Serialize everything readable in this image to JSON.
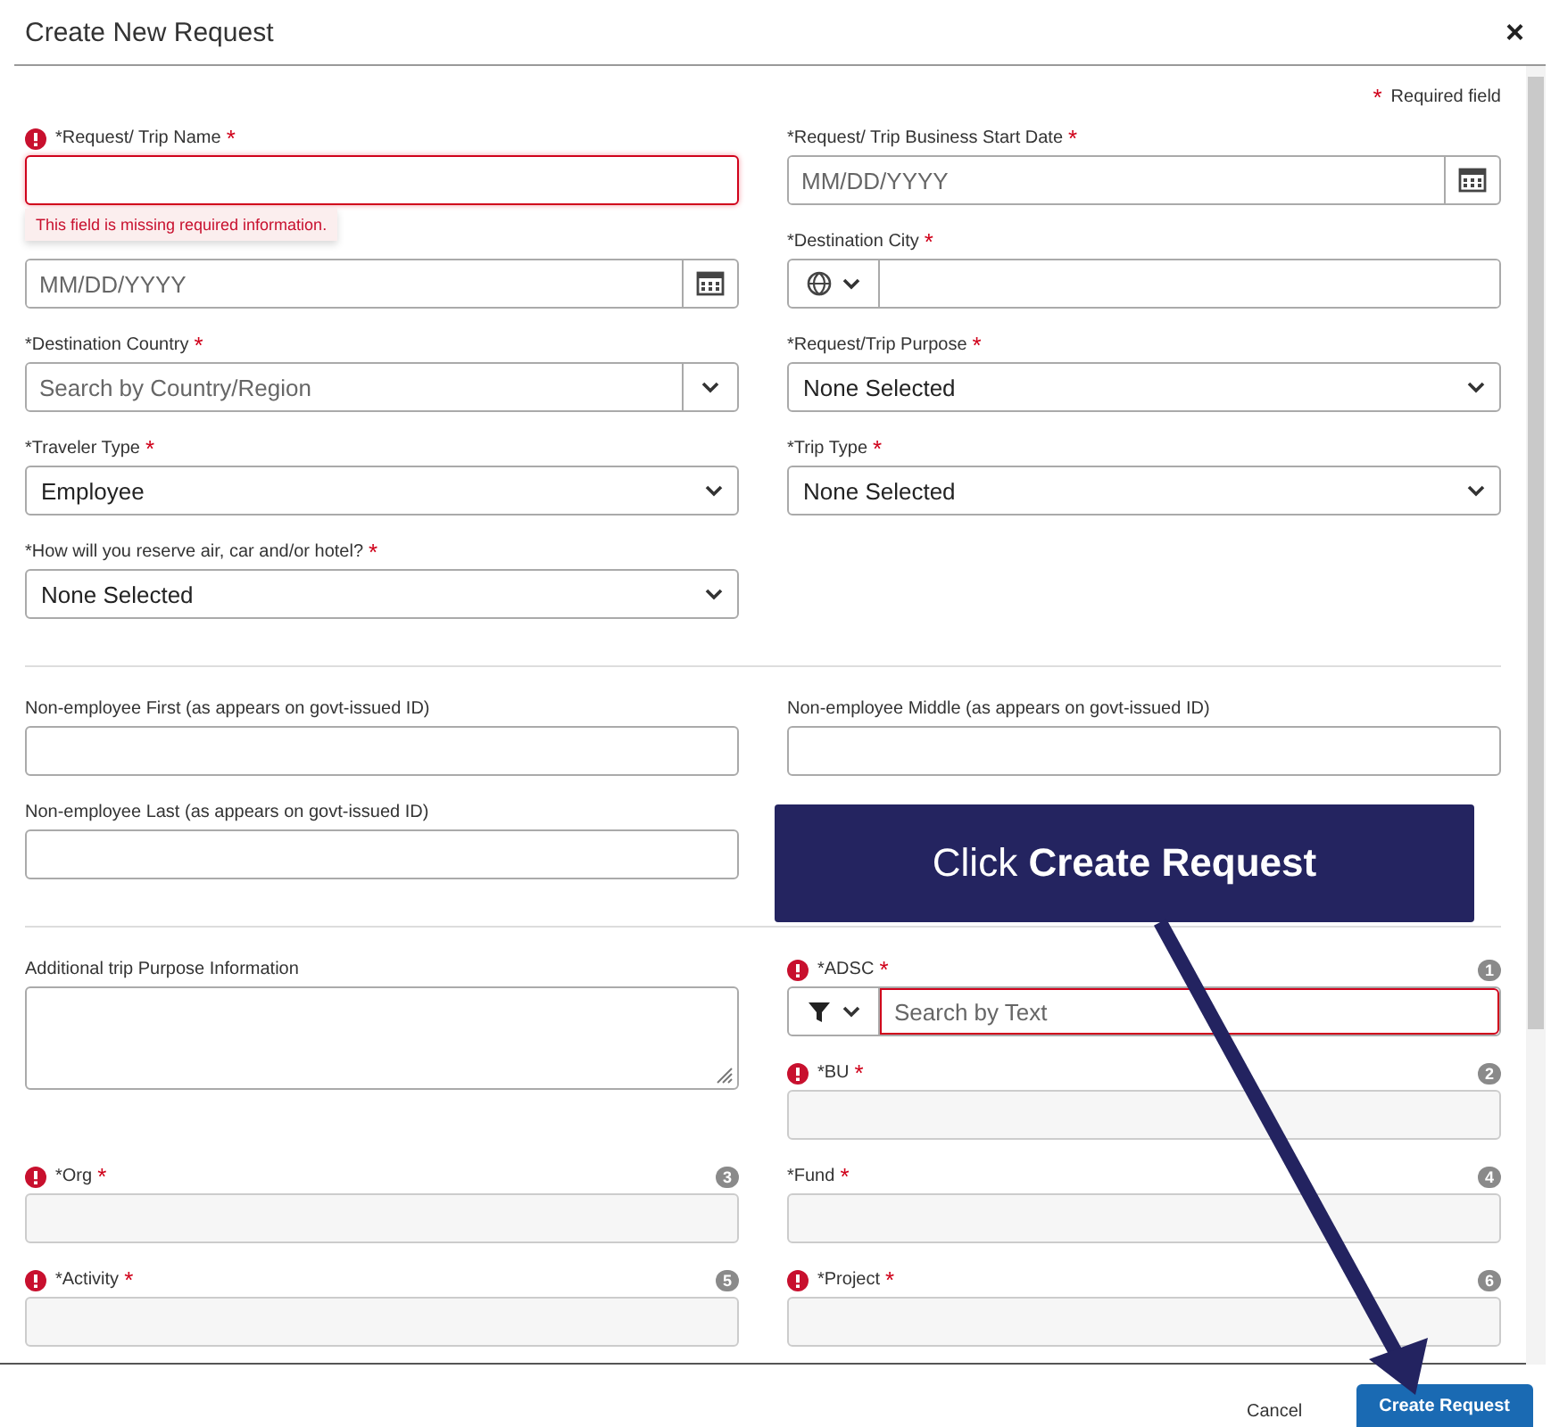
{
  "dialog": {
    "title": "Create New Request",
    "close": "×"
  },
  "required_note": {
    "mark": "*",
    "text": "Required field"
  },
  "sections": [
    {
      "fields": [
        {
          "kind": "text",
          "label": "*Request/ Trip Name",
          "mark": "*",
          "error": true,
          "focused": true,
          "error_message": "This field is missing required information."
        },
        {
          "kind": "date",
          "label": "*Request/ Trip Business Start Date",
          "mark": "*",
          "error": false,
          "placeholder": "MM/DD/YYYY"
        },
        {
          "kind": "date",
          "error": false,
          "placeholder": "MM/DD/YYYY"
        },
        {
          "kind": "city",
          "label": "*Destination City",
          "mark": "*",
          "error": false
        },
        {
          "kind": "combo",
          "label": "*Destination Country",
          "mark": "*",
          "error": false,
          "placeholder": "Search by Country/Region"
        },
        {
          "kind": "select",
          "label": "*Request/Trip Purpose",
          "mark": "*",
          "error": false,
          "value": "None Selected"
        },
        {
          "kind": "select",
          "label": "*Traveler Type",
          "mark": "*",
          "error": false,
          "value": "Employee"
        },
        {
          "kind": "select",
          "label": "*Trip Type",
          "mark": "*",
          "error": false,
          "value": "None Selected"
        },
        {
          "kind": "select",
          "label": "*How will you reserve air, car and/or hotel?",
          "mark": "*",
          "error": false,
          "value": "None Selected"
        }
      ]
    },
    {
      "fields": [
        {
          "kind": "text",
          "label": "Non-employee First (as appears on govt-issued ID)",
          "error": false
        },
        {
          "kind": "text",
          "label": "Non-employee Middle (as appears on govt-issued ID)",
          "error": false
        },
        {
          "kind": "text",
          "label": "Non-employee Last (as appears on govt-issued ID)",
          "error": false
        }
      ]
    },
    {
      "fields": [
        {
          "kind": "textarea",
          "label": "Additional trip Purpose Information",
          "error": false
        },
        {
          "kind": "filter",
          "label": "*ADSC",
          "mark": "*",
          "error": true,
          "badge": "1",
          "placeholder": "Search by Text"
        },
        {
          "kind": "locked",
          "label": "*BU",
          "mark": "*",
          "error": true,
          "badge": "2"
        },
        {
          "kind": "locked",
          "label": "*Org",
          "mark": "*",
          "error": true,
          "badge": "3"
        },
        {
          "kind": "locked",
          "label": "*Fund",
          "mark": "*",
          "error": false,
          "badge": "4"
        },
        {
          "kind": "locked",
          "label": "*Activity",
          "mark": "*",
          "error": true,
          "badge": "5"
        },
        {
          "kind": "locked",
          "label": "*Project",
          "mark": "*",
          "error": true,
          "badge": "6"
        }
      ]
    }
  ],
  "footer": {
    "cancel": "Cancel",
    "submit": "Create Request"
  },
  "callout": {
    "text": "Click **Create Request**"
  }
}
